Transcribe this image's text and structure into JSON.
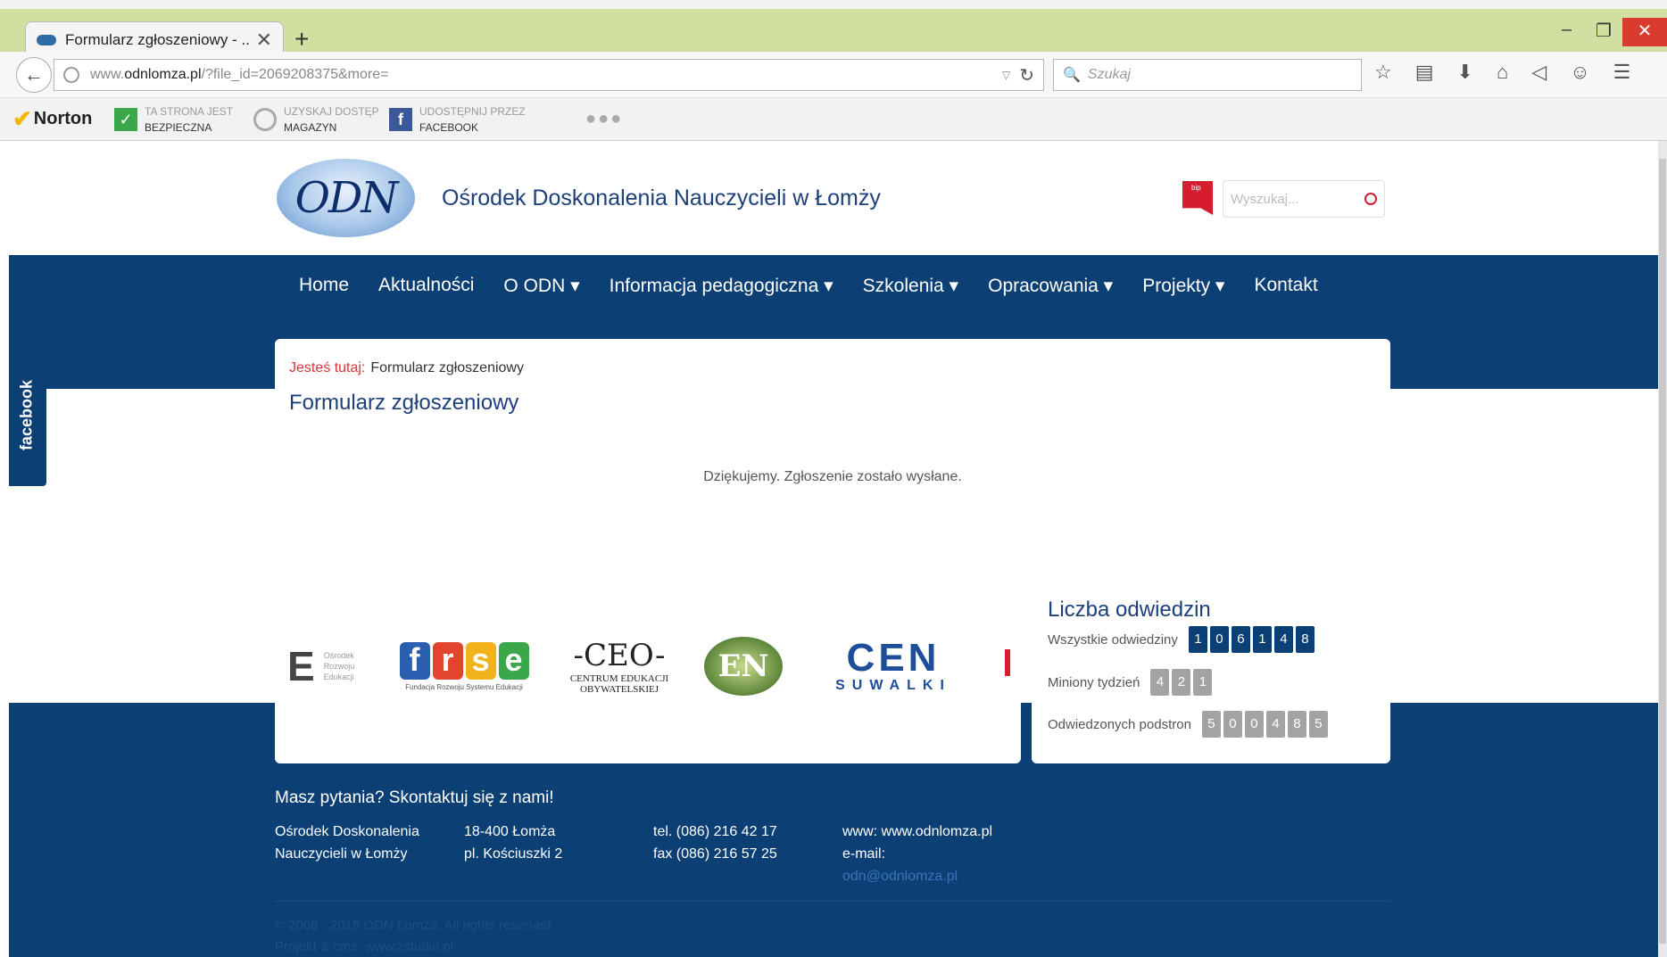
{
  "browser": {
    "tab_title": "Formularz zgłoszeniowy - ...",
    "url_plain": "www.",
    "url_domain": "odnlomza.pl",
    "url_rest": "/?file_id=2069208375&more=",
    "search_placeholder": "Szukaj"
  },
  "extensions": {
    "norton_label": "Norton",
    "safe_line1": "TA STRONA JEST",
    "safe_line2": "BEZPIECZNA",
    "store_line1": "UZYSKAJ DOSTĘP",
    "store_line2": "MAGAZYN",
    "share_line1": "UDOSTĘPNIJ PRZEZ",
    "share_line2": "FACEBOOK"
  },
  "header": {
    "logo_text": "ODN",
    "site_title": "Ośrodek Doskonalenia Nauczycieli w Łomży",
    "bip_label": "bip",
    "search_placeholder": "Wyszukaj..."
  },
  "menu": [
    {
      "label": "Home"
    },
    {
      "label": "Aktualności"
    },
    {
      "label": "O ODN ▾"
    },
    {
      "label": "Informacja pedagogiczna ▾"
    },
    {
      "label": "Szkolenia ▾"
    },
    {
      "label": "Opracowania ▾"
    },
    {
      "label": "Projekty ▾"
    },
    {
      "label": "Kontakt"
    }
  ],
  "main": {
    "breadcrumb_prefix": "Jesteś tutaj:",
    "breadcrumb_current": "Formularz zgłoszeniowy",
    "title": "Formularz zgłoszeniowy",
    "message": "Dziękujemy. Zgłoszenie zostało wysłane."
  },
  "partners": {
    "ore_letter": "E",
    "ore_small": "Ośrodek Rozwoju Edukacji",
    "frse_sub": "Fundacja Rozwoju Systemu Edukacji",
    "ceo_big": "-CEO-",
    "ceo_sub": "CENTRUM EDUKACJI OBYWATELSKIEJ",
    "en_label": "EN",
    "cen_big": "CEN",
    "cen_sub": "SUWALKI"
  },
  "visits": {
    "title": "Liczba odwiedzin",
    "all_label": "Wszystkie odwiedziny",
    "all_digits": [
      "1",
      "0",
      "6",
      "1",
      "4",
      "8"
    ],
    "week_label": "Miniony tydzień",
    "week_digits": [
      "4",
      "2",
      "1"
    ],
    "pages_label": "Odwiedzonych podstron",
    "pages_digits": [
      "5",
      "0",
      "0",
      "4",
      "8",
      "5"
    ]
  },
  "facebook_tab": "facebook",
  "footer": {
    "contact_head": "Masz pytania? Skontaktuj się z nami!",
    "org_line1": "Ośrodek Doskonalenia",
    "org_line2": "Nauczycieli w Łomży",
    "addr_line1": "18-400 Łomża",
    "addr_line2": "pl. Kościuszki 2",
    "tel": "tel. (086) 216 42 17",
    "fax": "fax (086) 216 57 25",
    "www": "www: www.odnlomza.pl",
    "email_label": "e-mail:",
    "email": "odn@odnlomza.pl",
    "copyright": "© 2008 - 2015 ODN Łomża. All rights reserved.",
    "project": "Projekt & cms: www.zstudio.pl"
  },
  "colors": {
    "brand_blue": "#0c3f73",
    "accent_red": "#d61d2d",
    "chrome_green": "#cfe0a0"
  }
}
